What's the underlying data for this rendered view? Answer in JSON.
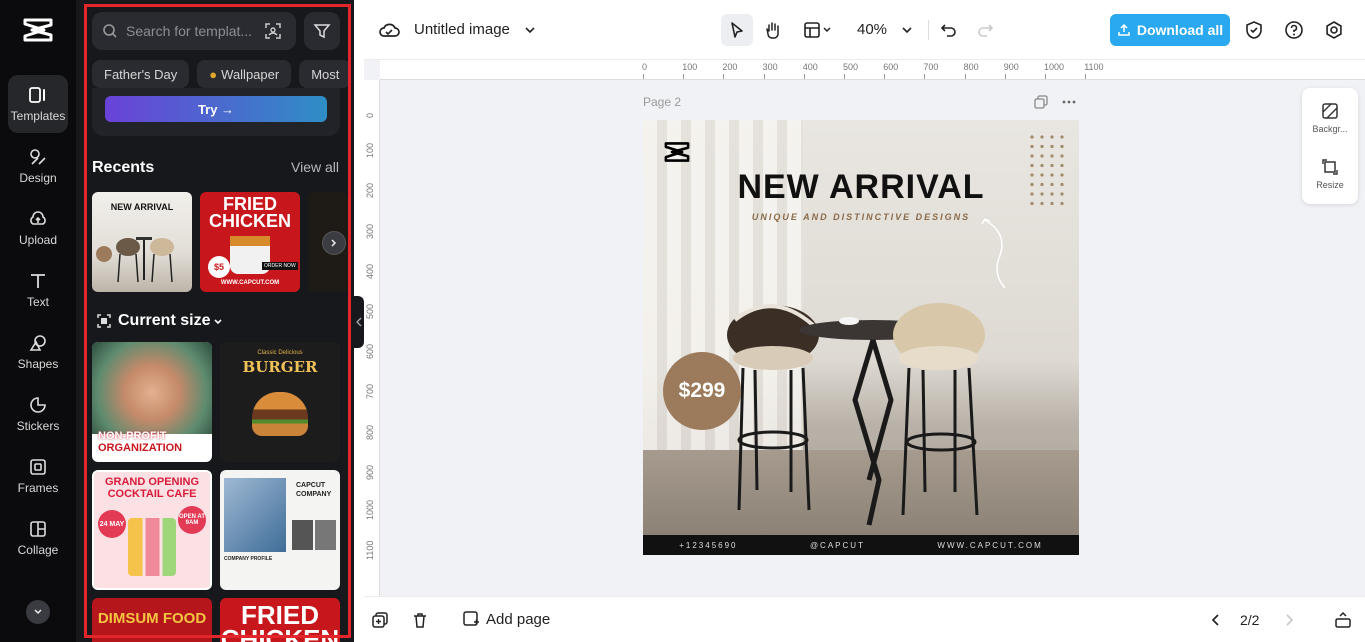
{
  "rail": {
    "items": [
      {
        "label": "Templates",
        "icon": "templates-icon"
      },
      {
        "label": "Design",
        "icon": "design-icon"
      },
      {
        "label": "Upload",
        "icon": "upload-icon"
      },
      {
        "label": "Text",
        "icon": "text-icon"
      },
      {
        "label": "Shapes",
        "icon": "shapes-icon"
      },
      {
        "label": "Stickers",
        "icon": "stickers-icon"
      },
      {
        "label": "Frames",
        "icon": "frames-icon"
      },
      {
        "label": "Collage",
        "icon": "collage-icon"
      }
    ]
  },
  "panel": {
    "search_placeholder": "Search for templat...",
    "chips": [
      "Father's Day",
      "Wallpaper",
      "Most"
    ],
    "try_label": "Try →",
    "recents_title": "Recents",
    "view_all": "View all",
    "current_size_title": "Current size",
    "recents": [
      {
        "title": "NEW ARRIVAL"
      },
      {
        "title": "FRIED CHICKEN",
        "price": "$5",
        "cta": "ORDER NOW",
        "url": "WWW.CAPCUT.COM"
      }
    ],
    "templates": [
      {
        "title1": "NON-PROFIT",
        "title2": "ORGANIZATION"
      },
      {
        "subtitle": "Classic Delicious",
        "title": "BURGER"
      },
      {
        "title1": "GRAND OPENING",
        "title2": "COCKTAIL CAFE",
        "badge1": "24 MAY",
        "badge2": "OPEN AT 9AM"
      },
      {
        "title1": "CAPCUT",
        "title2": "COMPANY",
        "caption": "COMPANY PROFILE"
      },
      {
        "title": "DIMSUM FOOD"
      },
      {
        "title1": "FRIED",
        "title2": "CHICKEN"
      }
    ]
  },
  "topbar": {
    "title": "Untitled image",
    "zoom": "40%",
    "download_label": "Download all"
  },
  "canvas": {
    "page_label": "Page 2",
    "ruler_top": [
      "0",
      "100",
      "200",
      "300",
      "400",
      "500",
      "600",
      "700",
      "800",
      "900",
      "1000",
      "1100"
    ],
    "ruler_left": [
      "0",
      "100",
      "200",
      "300",
      "400",
      "500",
      "600",
      "700",
      "800",
      "900",
      "1000",
      "1100"
    ],
    "design": {
      "headline": "NEW ARRIVAL",
      "subheadline": "UNIQUE AND DISTINCTIVE DESIGNS",
      "price": "$299",
      "footer": [
        "+12345690",
        "@CAPCUT",
        "WWW.CAPCUT.COM"
      ]
    }
  },
  "side_tools": {
    "background_label": "Backgr...",
    "resize_label": "Resize"
  },
  "bottombar": {
    "add_page_label": "Add page",
    "pager": "2/2"
  },
  "colors": {
    "accent": "#2aa8f0",
    "panel_bg": "#17181c",
    "highlight": "#e3262b"
  }
}
